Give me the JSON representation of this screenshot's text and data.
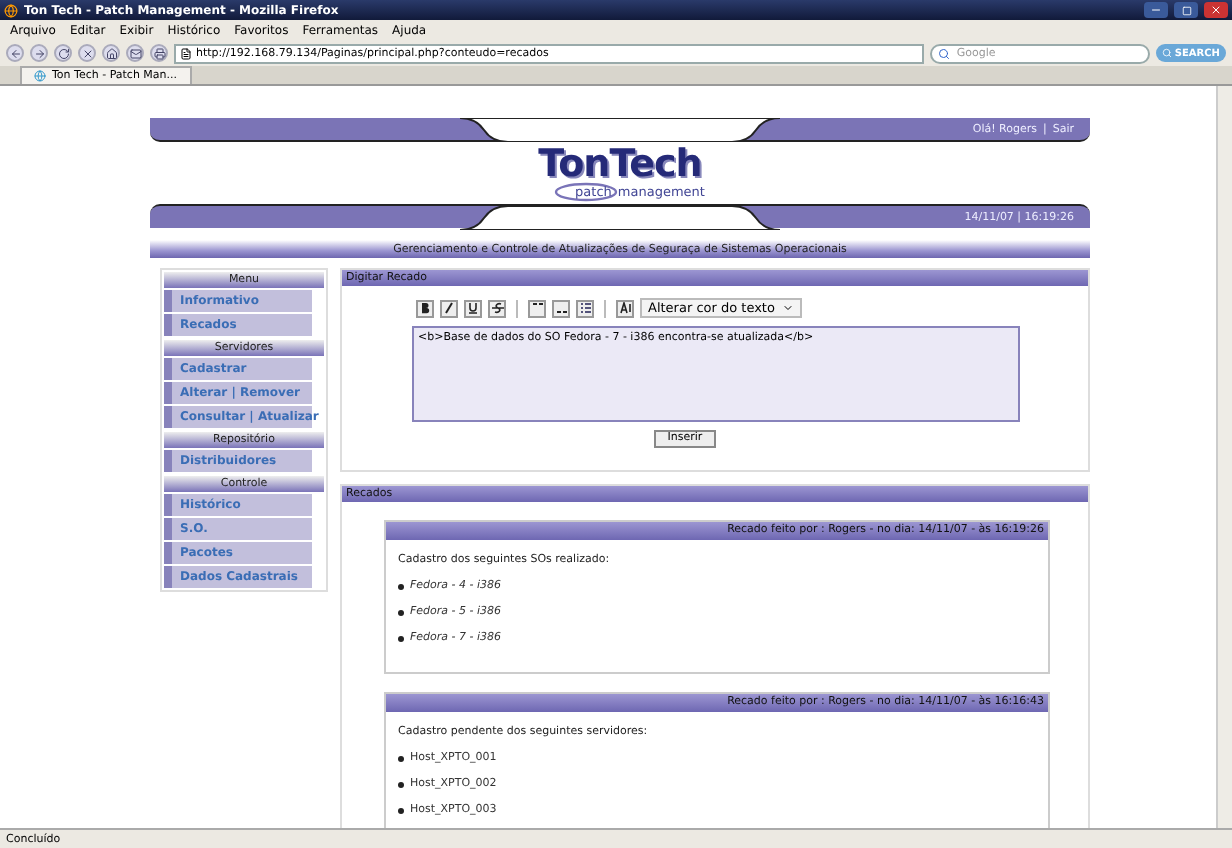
{
  "window": {
    "title": "Ton Tech - Patch Management - Mozilla Firefox"
  },
  "menu": [
    "Arquivo",
    "Editar",
    "Exibir",
    "Histórico",
    "Favoritos",
    "Ferramentas",
    "Ajuda"
  ],
  "address_bar": {
    "value": "http://192.168.79.134/Paginas/principal.php?conteudo=recados"
  },
  "search": {
    "placeholder": "Google",
    "button": "SEARCH"
  },
  "tabs": [
    {
      "label": "Ton Tech - Patch Man...",
      "selected": true
    }
  ],
  "header": {
    "greeting": "Olá! Rogers",
    "separator": "|",
    "logout": "Sair",
    "logo": "TonTech",
    "logo_sub_1": "patch",
    "logo_sub_2": "management",
    "datetime": "14/11/07 | 16:19:26"
  },
  "subtitle": "Gerenciamento e Controle de Atualizações de Seguraça de Sistemas Operacionais",
  "sidebar": {
    "sections": [
      {
        "title": "Menu",
        "items": [
          "Informativo",
          "Recados"
        ]
      },
      {
        "title": "Servidores",
        "items": [
          "Cadastrar",
          "Alterar | Remover",
          "Consultar | Atualizar"
        ]
      },
      {
        "title": "Repositório",
        "items": [
          "Distribuidores"
        ]
      },
      {
        "title": "Controle",
        "items": [
          "Histórico",
          "S.O.",
          "Pacotes",
          "Dados Cadastrais"
        ]
      }
    ]
  },
  "editor": {
    "title": "Digitar Recado",
    "color_select": "Alterar cor do texto",
    "value": "<b>Base de dados do SO Fedora - 7 - i386 encontra-se atualizada</b>",
    "button": "Inserir"
  },
  "messages_panel": {
    "title": "Recados",
    "messages": [
      {
        "header": "Recado feito por : Rogers - no dia: 14/11/07 - às 16:19:26",
        "intro": "Cadastro dos seguintes SOs realizado:",
        "italic": true,
        "items": [
          "Fedora - 4 - i386",
          "Fedora - 5 - i386",
          "Fedora - 7 - i386"
        ]
      },
      {
        "header": "Recado feito por : Rogers - no dia: 14/11/07 - às 16:16:43",
        "intro": "Cadastro pendente dos seguintes servidores:",
        "italic": false,
        "items": [
          "Host_XPTO_001",
          "Host_XPTO_002",
          "Host_XPTO_003"
        ]
      }
    ]
  },
  "status_bar": "Concluído"
}
